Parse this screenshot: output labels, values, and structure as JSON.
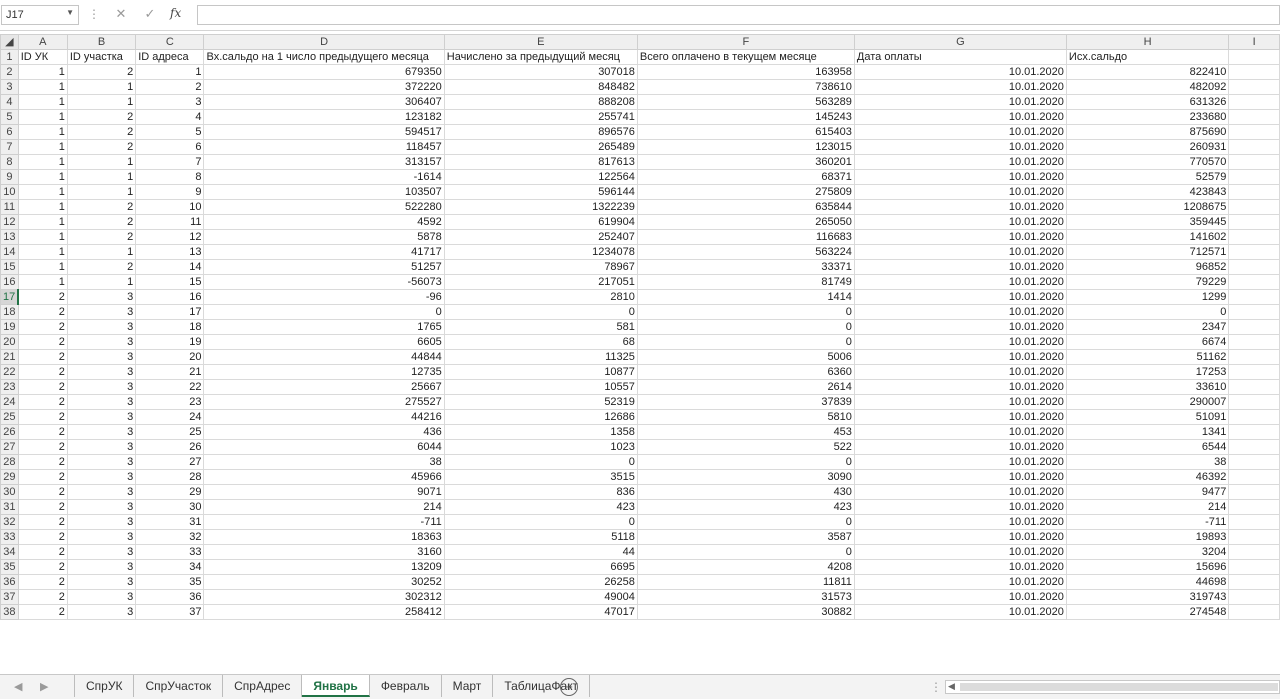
{
  "formula_bar": {
    "name_box": "J17",
    "formula": ""
  },
  "columns": [
    "A",
    "B",
    "C",
    "D",
    "E",
    "F",
    "G",
    "H",
    "I"
  ],
  "selected_row": "17",
  "headers": [
    "ID УК",
    "ID участка",
    "ID адреса",
    "Вх.сальдо на 1 число предыдущего месяца",
    "Начислено за предыдущий месяц",
    "Всего оплачено в текущем месяце",
    "Дата оплаты",
    "",
    "Исх.сальдо",
    ""
  ],
  "rows": [
    [
      "2",
      "1",
      "2",
      "1",
      "679350",
      "307018",
      "163958",
      "10.01.2020",
      "822410"
    ],
    [
      "3",
      "1",
      "1",
      "2",
      "372220",
      "848482",
      "738610",
      "10.01.2020",
      "482092"
    ],
    [
      "4",
      "1",
      "1",
      "3",
      "306407",
      "888208",
      "563289",
      "10.01.2020",
      "631326"
    ],
    [
      "5",
      "1",
      "2",
      "4",
      "123182",
      "255741",
      "145243",
      "10.01.2020",
      "233680"
    ],
    [
      "6",
      "1",
      "2",
      "5",
      "594517",
      "896576",
      "615403",
      "10.01.2020",
      "875690"
    ],
    [
      "7",
      "1",
      "2",
      "6",
      "118457",
      "265489",
      "123015",
      "10.01.2020",
      "260931"
    ],
    [
      "8",
      "1",
      "1",
      "7",
      "313157",
      "817613",
      "360201",
      "10.01.2020",
      "770570"
    ],
    [
      "9",
      "1",
      "1",
      "8",
      "-1614",
      "122564",
      "68371",
      "10.01.2020",
      "52579"
    ],
    [
      "10",
      "1",
      "1",
      "9",
      "103507",
      "596144",
      "275809",
      "10.01.2020",
      "423843"
    ],
    [
      "11",
      "1",
      "2",
      "10",
      "522280",
      "1322239",
      "635844",
      "10.01.2020",
      "1208675"
    ],
    [
      "12",
      "1",
      "2",
      "11",
      "4592",
      "619904",
      "265050",
      "10.01.2020",
      "359445"
    ],
    [
      "13",
      "1",
      "2",
      "12",
      "5878",
      "252407",
      "116683",
      "10.01.2020",
      "141602"
    ],
    [
      "14",
      "1",
      "1",
      "13",
      "41717",
      "1234078",
      "563224",
      "10.01.2020",
      "712571"
    ],
    [
      "15",
      "1",
      "2",
      "14",
      "51257",
      "78967",
      "33371",
      "10.01.2020",
      "96852"
    ],
    [
      "16",
      "1",
      "1",
      "15",
      "-56073",
      "217051",
      "81749",
      "10.01.2020",
      "79229"
    ],
    [
      "17",
      "2",
      "3",
      "16",
      "-96",
      "2810",
      "1414",
      "10.01.2020",
      "1299"
    ],
    [
      "18",
      "2",
      "3",
      "17",
      "0",
      "0",
      "0",
      "10.01.2020",
      "0"
    ],
    [
      "19",
      "2",
      "3",
      "18",
      "1765",
      "581",
      "0",
      "10.01.2020",
      "2347"
    ],
    [
      "20",
      "2",
      "3",
      "19",
      "6605",
      "68",
      "0",
      "10.01.2020",
      "6674"
    ],
    [
      "21",
      "2",
      "3",
      "20",
      "44844",
      "11325",
      "5006",
      "10.01.2020",
      "51162"
    ],
    [
      "22",
      "2",
      "3",
      "21",
      "12735",
      "10877",
      "6360",
      "10.01.2020",
      "17253"
    ],
    [
      "23",
      "2",
      "3",
      "22",
      "25667",
      "10557",
      "2614",
      "10.01.2020",
      "33610"
    ],
    [
      "24",
      "2",
      "3",
      "23",
      "275527",
      "52319",
      "37839",
      "10.01.2020",
      "290007"
    ],
    [
      "25",
      "2",
      "3",
      "24",
      "44216",
      "12686",
      "5810",
      "10.01.2020",
      "51091"
    ],
    [
      "26",
      "2",
      "3",
      "25",
      "436",
      "1358",
      "453",
      "10.01.2020",
      "1341"
    ],
    [
      "27",
      "2",
      "3",
      "26",
      "6044",
      "1023",
      "522",
      "10.01.2020",
      "6544"
    ],
    [
      "28",
      "2",
      "3",
      "27",
      "38",
      "0",
      "0",
      "10.01.2020",
      "38"
    ],
    [
      "29",
      "2",
      "3",
      "28",
      "45966",
      "3515",
      "3090",
      "10.01.2020",
      "46392"
    ],
    [
      "30",
      "2",
      "3",
      "29",
      "9071",
      "836",
      "430",
      "10.01.2020",
      "9477"
    ],
    [
      "31",
      "2",
      "3",
      "30",
      "214",
      "423",
      "423",
      "10.01.2020",
      "214"
    ],
    [
      "32",
      "2",
      "3",
      "31",
      "-711",
      "0",
      "0",
      "10.01.2020",
      "-711"
    ],
    [
      "33",
      "2",
      "3",
      "32",
      "18363",
      "5118",
      "3587",
      "10.01.2020",
      "19893"
    ],
    [
      "34",
      "2",
      "3",
      "33",
      "3160",
      "44",
      "0",
      "10.01.2020",
      "3204"
    ],
    [
      "35",
      "2",
      "3",
      "34",
      "13209",
      "6695",
      "4208",
      "10.01.2020",
      "15696"
    ],
    [
      "36",
      "2",
      "3",
      "35",
      "30252",
      "26258",
      "11811",
      "10.01.2020",
      "44698"
    ],
    [
      "37",
      "2",
      "3",
      "36",
      "302312",
      "49004",
      "31573",
      "10.01.2020",
      "319743"
    ],
    [
      "38",
      "2",
      "3",
      "37",
      "258412",
      "47017",
      "30882",
      "10.01.2020",
      "274548"
    ]
  ],
  "sheet_tabs": [
    "СпрУК",
    "СпрУчасток",
    "СпрАдрес",
    "Январь",
    "Февраль",
    "Март",
    "ТаблицаФакт"
  ],
  "active_tab": "Январь",
  "colors": {
    "accent": "#217346",
    "header_bg": "#efefef",
    "grid_line": "#dadada"
  }
}
